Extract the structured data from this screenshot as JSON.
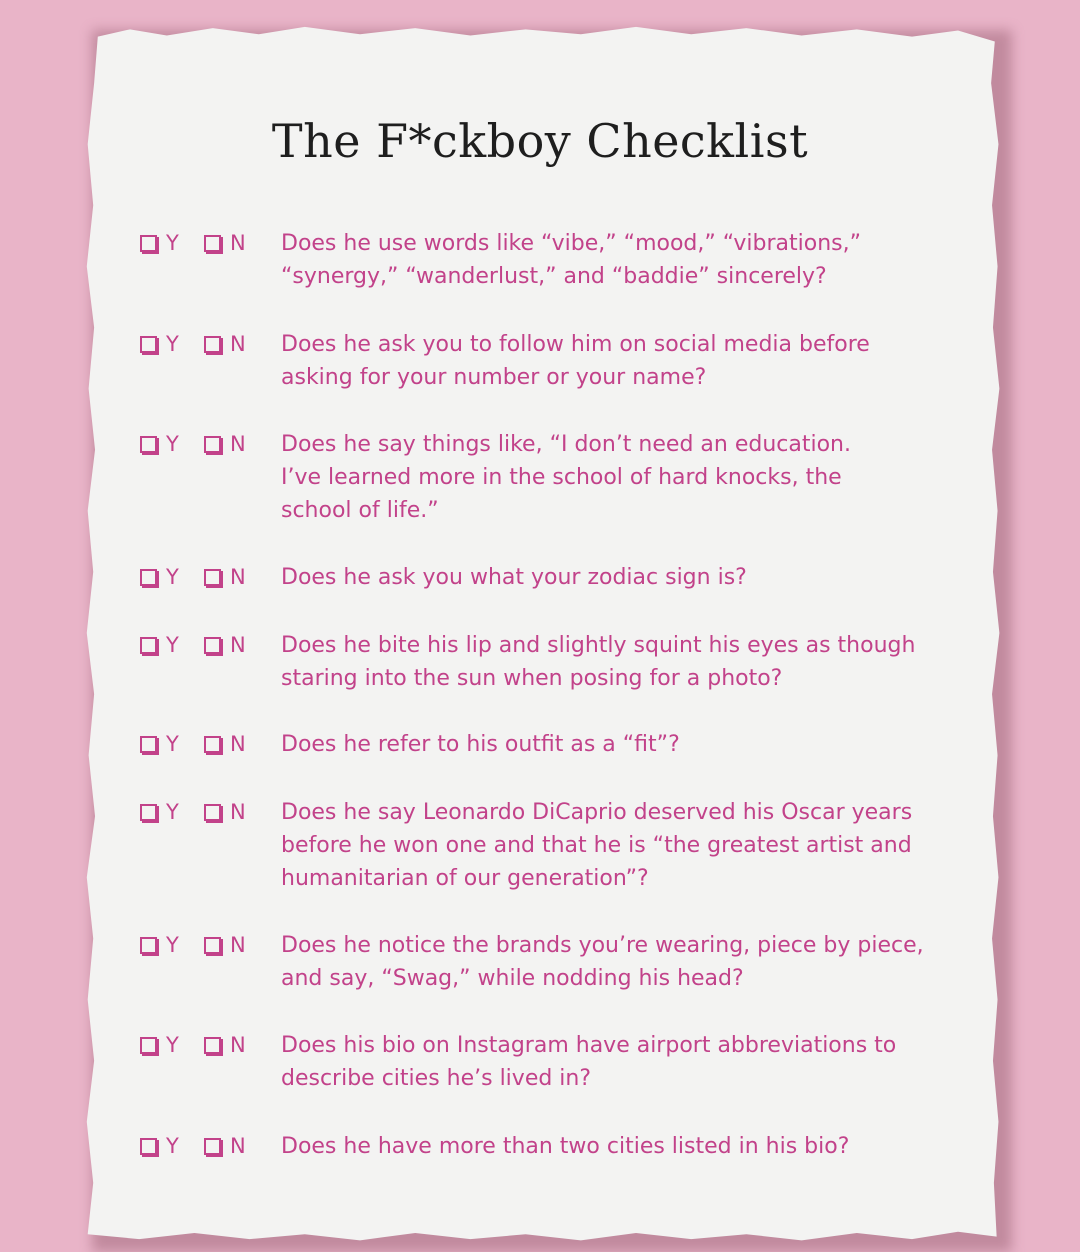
{
  "title": "The F*ckboy Checklist",
  "choice_yes": "Y",
  "choice_no": "N",
  "questions": [
    "Does he use words like “vibe,” “mood,” “vibrations,”\n“synergy,” “wanderlust,” and “baddie” sincerely?",
    "Does he ask you to follow him on social media before\nasking for your number or your name?",
    "Does he say things like, “I don’t need an education.\nI’ve learned more in the school of hard knocks, the\nschool of life.”",
    "Does he ask you what your zodiac sign is?",
    "Does he bite his lip and slightly squint his eyes as though\nstaring into the sun when posing for a photo?",
    "Does he refer to his outfit as a “fit”?",
    "Does he say Leonardo DiCaprio deserved his Oscar years\nbefore he won one and that he is “the greatest artist and\nhumanitarian of our generation”?",
    "Does he notice the brands you’re wearing, piece by piece,\nand say, “Swag,” while nodding his head?",
    "Does his bio on Instagram have airport abbreviations to\ndescribe cities he’s lived in?",
    "Does he have more than two cities listed in his bio?"
  ],
  "colors": {
    "background": "#e9b4c8",
    "paper": "#f3f3f2",
    "accent": "#c2428a",
    "title": "#1e1e1e"
  }
}
